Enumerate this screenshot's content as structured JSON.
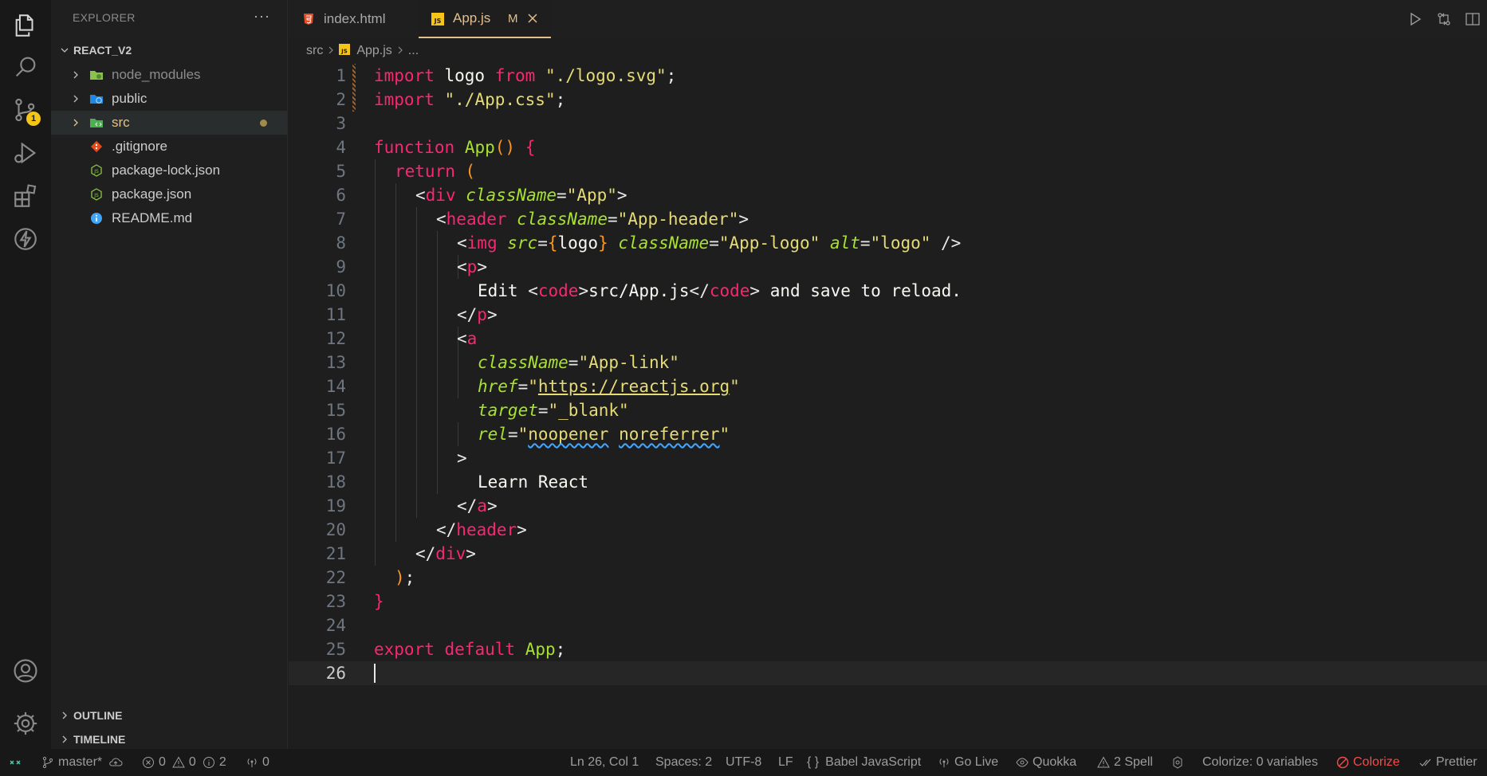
{
  "activity": {
    "source_control_badge": "1"
  },
  "sidebar": {
    "title": "EXPLORER",
    "more": "···",
    "root": "REACT_V2",
    "items": [
      {
        "label": "node_modules",
        "type": "folder",
        "color": "#8c8c8c"
      },
      {
        "label": "public",
        "type": "folder",
        "color": "#cccccc"
      },
      {
        "label": "src",
        "type": "folder",
        "color": "#e2c08d"
      },
      {
        "label": ".gitignore",
        "type": "file",
        "color": "#cccccc"
      },
      {
        "label": "package-lock.json",
        "type": "file",
        "color": "#cccccc"
      },
      {
        "label": "package.json",
        "type": "file",
        "color": "#cccccc"
      },
      {
        "label": "README.md",
        "type": "file",
        "color": "#cccccc"
      }
    ],
    "outline": "OUTLINE",
    "timeline": "TIMELINE"
  },
  "tabs": [
    {
      "label": "index.html",
      "icon": "html5-icon"
    },
    {
      "label": "App.js",
      "icon": "js-icon",
      "status": "M"
    }
  ],
  "breadcrumb": {
    "folder": "src",
    "file": "App.js",
    "symbol": "..."
  },
  "editor": {
    "line_numbers": [
      "1",
      "2",
      "3",
      "4",
      "5",
      "6",
      "7",
      "8",
      "9",
      "10",
      "11",
      "12",
      "13",
      "14",
      "15",
      "16",
      "17",
      "18",
      "19",
      "20",
      "21",
      "22",
      "23",
      "24",
      "25",
      "26"
    ]
  },
  "code": {
    "l1": [
      "import",
      " logo ",
      "from",
      " ",
      "\"./logo.svg\"",
      ";"
    ],
    "l2": [
      "import",
      " ",
      "\"./App.css\"",
      ";"
    ],
    "l4": [
      "function",
      " ",
      "App",
      "()",
      " ",
      "{"
    ],
    "l5": [
      "return",
      " ",
      "("
    ],
    "l6": [
      "<",
      "div",
      " ",
      "className",
      "=",
      "\"App\"",
      ">"
    ],
    "l7": [
      "<",
      "header",
      " ",
      "className",
      "=",
      "\"App-header\"",
      ">"
    ],
    "l8": [
      "<",
      "img",
      " ",
      "src",
      "=",
      "{",
      "logo",
      "}",
      " ",
      "className",
      "=",
      "\"App-logo\"",
      " ",
      "alt",
      "=",
      "\"logo\"",
      " />"
    ],
    "l9": [
      "<",
      "p",
      ">"
    ],
    "l10": [
      "Edit ",
      "<",
      "code",
      ">",
      "src/App.js",
      "</",
      "code",
      ">",
      " and save to reload."
    ],
    "l11": [
      "</",
      "p",
      ">"
    ],
    "l12": [
      "<",
      "a"
    ],
    "l13": [
      "className",
      "=",
      "\"App-link\""
    ],
    "l14": [
      "href",
      "=",
      "\"",
      "https://reactjs.org",
      "\""
    ],
    "l15": [
      "target",
      "=",
      "\"_blank\""
    ],
    "l16": [
      "rel",
      "=",
      "\"",
      "noopener",
      " ",
      "noreferrer",
      "\""
    ],
    "l17": [
      ">"
    ],
    "l18": [
      "Learn React"
    ],
    "l19": [
      "</",
      "a",
      ">"
    ],
    "l20": [
      "</",
      "header",
      ">"
    ],
    "l21": [
      "</",
      "div",
      ">"
    ],
    "l22": [
      ")",
      ";"
    ],
    "l23": [
      "}"
    ],
    "l25": [
      "export",
      " ",
      "default",
      " ",
      "App",
      ";"
    ]
  },
  "status": {
    "branch": "master*",
    "errors": "0",
    "warnings": "0",
    "infos": "2",
    "ports": "0",
    "position": "Ln 26, Col 1",
    "spaces": "Spaces: 2",
    "encoding": "UTF-8",
    "eol": "LF",
    "language": "Babel JavaScript",
    "golive": "Go Live",
    "quokka": "Quokka",
    "spell": "2 Spell",
    "colorize_vars": "Colorize: 0 variables",
    "colorize": "Colorize",
    "prettier": "Prettier"
  },
  "colors": {
    "accent_tab": "#e2c08d",
    "badge": "#f5c518",
    "colorize": "#f14c4c"
  }
}
